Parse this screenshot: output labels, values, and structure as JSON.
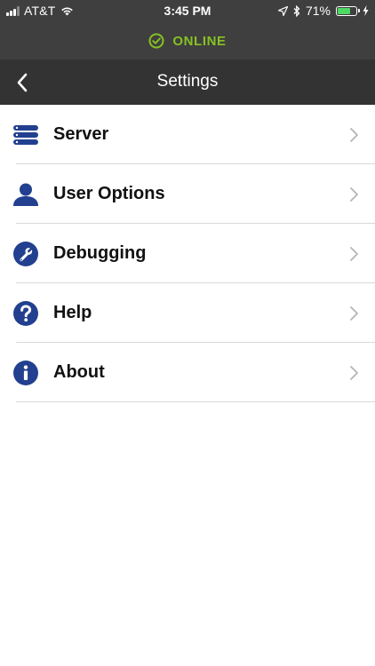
{
  "status_bar": {
    "carrier": "AT&T",
    "time": "3:45 PM",
    "battery_text": "71%",
    "battery_level": 0.71
  },
  "connection": {
    "status": "ONLINE",
    "color": "#86c123"
  },
  "nav": {
    "title": "Settings",
    "back_icon": "chevron-left-icon"
  },
  "settings": {
    "items": [
      {
        "label": "Server",
        "icon": "server-icon"
      },
      {
        "label": "User Options",
        "icon": "user-icon"
      },
      {
        "label": "Debugging",
        "icon": "wrench-icon"
      },
      {
        "label": "Help",
        "icon": "question-icon"
      },
      {
        "label": "About",
        "icon": "info-icon"
      }
    ]
  },
  "colors": {
    "icon_blue": "#22408f",
    "chevron_gray": "#b5b5b5",
    "header_dark": "#3f3f3f",
    "nav_dark": "#333333"
  }
}
